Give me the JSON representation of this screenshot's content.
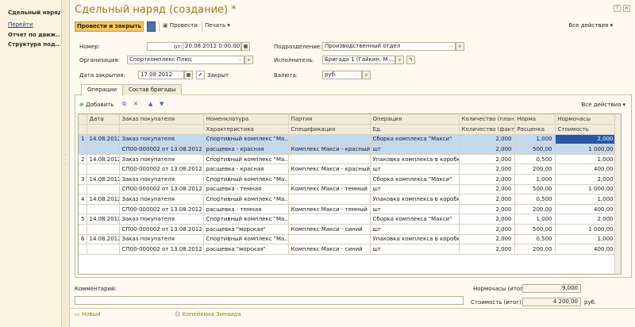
{
  "left_panel": {
    "title": "Сдельный наряд ...",
    "nav_header": "Перейти",
    "items": [
      "Отчет по движ...",
      "Структура под..."
    ]
  },
  "form": {
    "title": "Сдельный наряд (создание) *"
  },
  "toolbar": {
    "post_close": "Провести и закрыть",
    "post": "Провести",
    "print": "Печать",
    "all_actions": "Все действия"
  },
  "fields": {
    "number_label": "Номер:",
    "number_value": "",
    "date_label": "от:",
    "date_value": "20.08.2012  0:00:00",
    "org_label": "Организация:",
    "org_value": "Спорткомплекс Плюс",
    "close_date_label": "Дата закрытия:",
    "close_date_value": "17.08.2012",
    "closed_label": "Закрыт",
    "dept_label": "Подразделение:",
    "dept_value": "Производственный отдел",
    "executor_label": "Исполнитель:",
    "executor_value": "Бригада 1 (Гайкин, М ...",
    "currency_label": "Валюта:",
    "currency_value": "руб."
  },
  "tabs": [
    "Операции",
    "Состав бригады"
  ],
  "grid_toolbar": {
    "add": "Добавить",
    "all_actions": "Все действия"
  },
  "table": {
    "headers_top": [
      "",
      "Дата",
      "Заказ покупателя",
      "Номенклатура",
      "Партия",
      "Операция",
      "Количество (план)",
      "Норма",
      "Нормочасы"
    ],
    "headers_bottom": [
      "",
      "",
      "",
      "Характеристика",
      "Спецификация",
      "Ед.",
      "Количество (факт)",
      "Расценка",
      "Стоимость"
    ],
    "rows": [
      {
        "n": "1",
        "date": "14.08.2012",
        "order1": "Заказ покупателя",
        "order2": "СП00-000002 от 13.08.2012 ...",
        "nom": "Спортивный комплекс \"Ма...",
        "char": "расщевка - красная",
        "batch": "",
        "spec": "Комплекс Макси - красный",
        "op": "Сборка комплекса \"Макси\"",
        "unit": "шт",
        "qplan": "2,000",
        "qfact": "2,000",
        "norm": "1,000",
        "rate": "500,00",
        "hours": "2,000",
        "cost": "1 000,00"
      },
      {
        "n": "2",
        "date": "14.08.2012",
        "order1": "Заказ покупателя",
        "order2": "СП00-000002 от 13.08.2012 ...",
        "nom": "Спортивный комплекс \"Ма...",
        "char": "расщевка - красная",
        "batch": "",
        "spec": "Комплекс Макси - красный",
        "op": "Упаковка комплекса в коробку",
        "unit": "шт",
        "qplan": "2,000",
        "qfact": "2,000",
        "norm": "0,500",
        "rate": "200,00",
        "hours": "1,000",
        "cost": "400,00"
      },
      {
        "n": "3",
        "date": "14.08.2012",
        "order1": "Заказ покупателя",
        "order2": "СП00-000002 от 13.08.2012 ...",
        "nom": "Спортивный комплекс \"Ма...",
        "char": "расщевка - темная",
        "batch": "",
        "spec": "Комплекс Макси - темный",
        "op": "Сборка комплекса \"Макси\"",
        "unit": "шт",
        "qplan": "2,000",
        "qfact": "2,000",
        "norm": "1,000",
        "rate": "500,00",
        "hours": "2,000",
        "cost": "1 000,00"
      },
      {
        "n": "4",
        "date": "14.08.2012",
        "order1": "Заказ покупателя",
        "order2": "СП00-000002 от 13.08.2012 ...",
        "nom": "Спортивный комплекс \"Ма...",
        "char": "расщевка - темная",
        "batch": "",
        "spec": "Комплекс Макси - темный",
        "op": "Упаковка комплекса в коробку",
        "unit": "шт",
        "qplan": "2,000",
        "qfact": "2,000",
        "norm": "0,500",
        "rate": "200,00",
        "hours": "1,000",
        "cost": "400,00"
      },
      {
        "n": "5",
        "date": "14.08.2012",
        "order1": "Заказ покупателя",
        "order2": "СП00-000002 от 13.08.2012 ...",
        "nom": "Спортивный комплекс \"Ма...",
        "char": "расщевка \"морская\"",
        "batch": "",
        "spec": "Комплекс Макси - синий",
        "op": "Сборка комплекса \"Макси\"",
        "unit": "шт",
        "qplan": "2,000",
        "qfact": "2,000",
        "norm": "1,000",
        "rate": "500,00",
        "hours": "2,000",
        "cost": "1 000,00"
      },
      {
        "n": "6",
        "date": "14.08.2012",
        "order1": "Заказ покупателя",
        "order2": "СП00-000002 от 13.08.2012 ...",
        "nom": "Спортивный комплекс \"Ма...",
        "char": "расщевка \"морская\"",
        "batch": "",
        "spec": "Комплекс Макси - синий",
        "op": "Упаковка комплекса в коробку",
        "unit": "шт",
        "qplan": "2,000",
        "qfact": "2,000",
        "norm": "0,500",
        "rate": "200,00",
        "hours": "1,000",
        "cost": "400,00"
      }
    ]
  },
  "totals": {
    "comment_label": "Комментарий:",
    "comment_value": "",
    "hours_label": "Нормочасы (итог):",
    "hours_value": "9,000",
    "cost_label": "Стоимость (итог):",
    "cost_value": "4 200,00",
    "cost_unit": "руб."
  },
  "status": {
    "state": "Новый",
    "user": "Копейкина Зинаида"
  },
  "colors": {
    "accent": "#a0751f",
    "button": "#f4c560",
    "selection": "#c2d9f0",
    "active_cell": "#2a56a8"
  }
}
